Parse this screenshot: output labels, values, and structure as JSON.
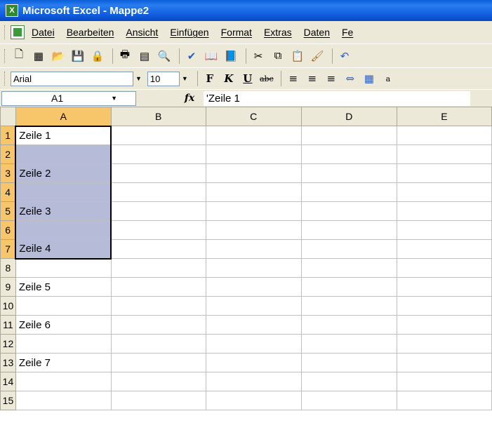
{
  "window": {
    "title": "Microsoft Excel - Mappe2"
  },
  "menu": {
    "items": [
      "Datei",
      "Bearbeiten",
      "Ansicht",
      "Einfügen",
      "Format",
      "Extras",
      "Daten",
      "Fe"
    ]
  },
  "toolbar": {
    "icons": [
      "new-icon",
      "open-icon",
      "folder-icon",
      "save-icon",
      "permission-icon",
      "print-icon",
      "print-preview-icon",
      "research-icon",
      "spelling-icon",
      "research-book-icon",
      "translate-icon",
      "cut-icon",
      "copy-icon",
      "paste-icon",
      "format-painter-icon",
      "undo-icon"
    ]
  },
  "format": {
    "font": "Arial",
    "size": "10",
    "bold": "F",
    "italic": "K",
    "underline": "U",
    "strike": "abc"
  },
  "formula": {
    "cell_ref": "A1",
    "fx": "fx",
    "content": "'Zeile 1"
  },
  "sheet": {
    "columns": [
      "A",
      "B",
      "C",
      "D",
      "E"
    ],
    "rows": [
      "1",
      "2",
      "3",
      "4",
      "5",
      "6",
      "7",
      "8",
      "9",
      "10",
      "11",
      "12",
      "13",
      "14",
      "15"
    ],
    "cells": [
      "Zeile 1",
      "",
      "Zeile 2",
      "",
      "Zeile 3",
      "",
      "Zeile 4",
      "",
      "Zeile 5",
      "",
      "Zeile 6",
      "",
      "Zeile 7",
      "",
      ""
    ],
    "selection": "A1:A7"
  },
  "colors": {
    "selection": "#b6bbd8",
    "header_sel": "#f7c66b"
  }
}
